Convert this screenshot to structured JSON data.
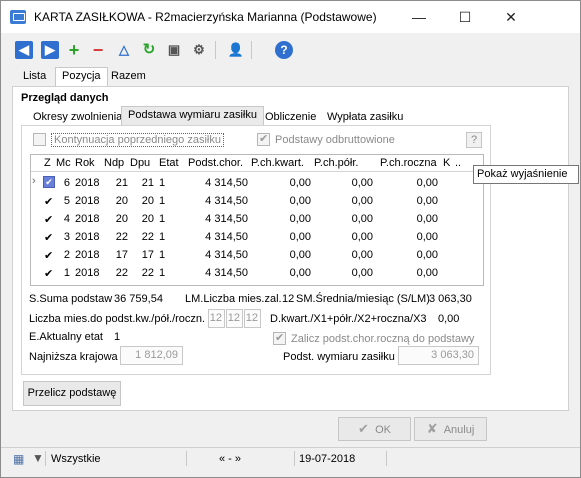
{
  "window": {
    "title": "KARTA ZASIŁKOWA - R2macierzyńska Marianna (Podstawowe)",
    "minimize": "—",
    "maximize": "☐",
    "close": "✕"
  },
  "toolbar": {
    "icons": [
      "prev-icon",
      "next-icon",
      "add-icon",
      "delete-icon",
      "filter-icon",
      "refresh-icon",
      "print-icon",
      "settings-icon",
      "add-user-icon",
      "help-icon"
    ]
  },
  "main_tabs": [
    {
      "label": "Lista"
    },
    {
      "label": "Pozycja"
    },
    {
      "label": "Razem"
    }
  ],
  "section_title": "Przegląd danych",
  "sub_tabs": [
    {
      "label": "Okresy zwolnienia"
    },
    {
      "label": "Podstawa wymiaru zasiłku"
    },
    {
      "label": "Obliczenie"
    },
    {
      "label": "Wypłata zasiłku"
    }
  ],
  "options": {
    "continuation_label": "Kontynuacja poprzedniego zasiłku",
    "gross_label": "Podstawy odbruttowione",
    "help": "?"
  },
  "grid": {
    "headers": [
      "Z",
      "Mc",
      "Rok",
      "Ndp",
      "Dpu",
      "Etat",
      "Podst.chor.",
      "P.ch.kwart.",
      "P.ch.półr.",
      "P.ch.roczna",
      "K",
      ".."
    ],
    "rows": [
      {
        "z": "✔",
        "mc": "6",
        "rok": "2018",
        "ndp": "21",
        "dpu": "21",
        "etat": "1",
        "podst": "4 314,50",
        "kw": "0,00",
        "polr": "0,00",
        "rocz": "0,00"
      },
      {
        "z": "✔",
        "mc": "5",
        "rok": "2018",
        "ndp": "20",
        "dpu": "20",
        "etat": "1",
        "podst": "4 314,50",
        "kw": "0,00",
        "polr": "0,00",
        "rocz": "0,00"
      },
      {
        "z": "✔",
        "mc": "4",
        "rok": "2018",
        "ndp": "20",
        "dpu": "20",
        "etat": "1",
        "podst": "4 314,50",
        "kw": "0,00",
        "polr": "0,00",
        "rocz": "0,00"
      },
      {
        "z": "✔",
        "mc": "3",
        "rok": "2018",
        "ndp": "22",
        "dpu": "22",
        "etat": "1",
        "podst": "4 314,50",
        "kw": "0,00",
        "polr": "0,00",
        "rocz": "0,00"
      },
      {
        "z": "✔",
        "mc": "2",
        "rok": "2018",
        "ndp": "17",
        "dpu": "17",
        "etat": "1",
        "podst": "4 314,50",
        "kw": "0,00",
        "polr": "0,00",
        "rocz": "0,00"
      },
      {
        "z": "✔",
        "mc": "1",
        "rok": "2018",
        "ndp": "22",
        "dpu": "22",
        "etat": "1",
        "podst": "4 314,50",
        "kw": "0,00",
        "polr": "0,00",
        "rocz": "0,00"
      }
    ]
  },
  "tooltip": "Pokaż wyjaśnienie",
  "summary": {
    "suma_label": "S.Suma podstaw",
    "suma_value": "36 759,54",
    "lm_label": "LM.Liczba mies.zal.",
    "lm_value": "12",
    "sm_label": "SM.Średnia/miesiąc (S/LM)",
    "sm_value": "3 063,30",
    "liczba_label": "Liczba mies.do podst.kw./pół./roczn.",
    "liczba_values": [
      "12",
      "12",
      "12"
    ],
    "dkwart_label": "D.kwart./X1+półr./X2+roczna/X3",
    "dkwart_value": "0,00",
    "etat_label": "E.Aktualny etat",
    "etat_value": "1",
    "zalicz_label": "Zalicz podst.chor.roczną do podstawy",
    "krajowa_label": "Najniższa krajowa",
    "krajowa_value": "1 812,09",
    "podst_label": "Podst. wymiaru zasiłku",
    "podst_value": "3 063,30"
  },
  "buttons": {
    "recalc": "Przelicz podstawę",
    "ok": "OK",
    "cancel": "Anuluj"
  },
  "status": {
    "filter": "Wszystkie",
    "nav": "« - »",
    "date": "19-07-2018"
  }
}
